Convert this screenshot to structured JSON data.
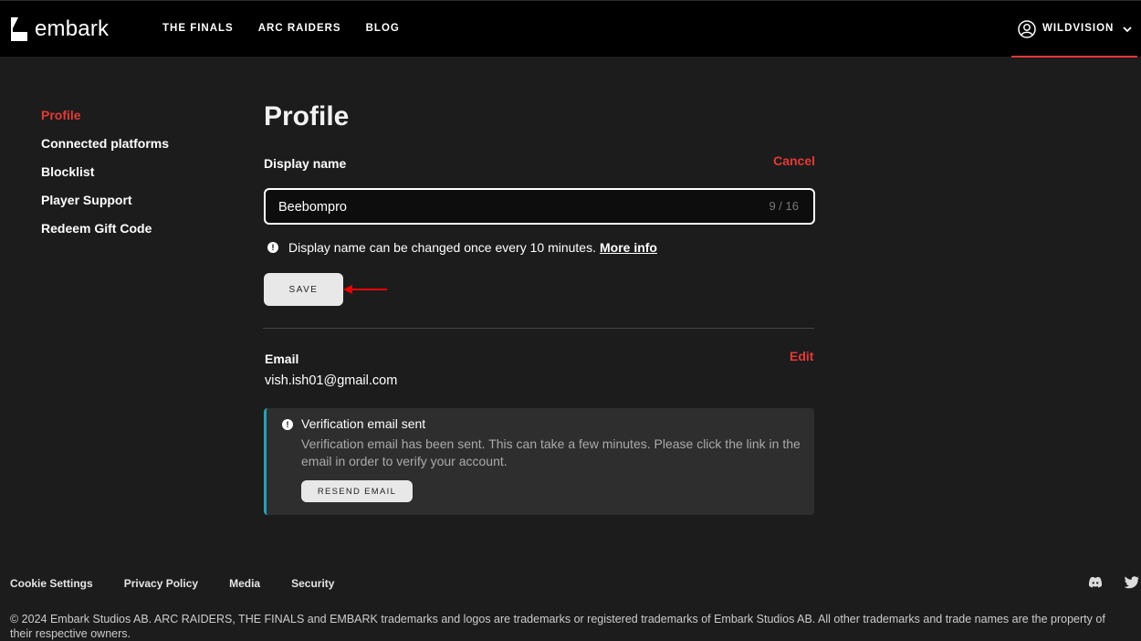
{
  "header": {
    "brand": "embark",
    "nav": [
      "THE FINALS",
      "ARC RAIDERS",
      "BLOG"
    ],
    "username": "WILDVISION",
    "accent_color": "#e53935"
  },
  "sidebar": {
    "items": [
      {
        "label": "Profile",
        "active": true
      },
      {
        "label": "Connected platforms",
        "active": false
      },
      {
        "label": "Blocklist",
        "active": false
      },
      {
        "label": "Player Support",
        "active": false
      },
      {
        "label": "Redeem Gift Code",
        "active": false
      }
    ]
  },
  "profile": {
    "title": "Profile",
    "display_name_label": "Display name",
    "cancel_label": "Cancel",
    "display_name_value": "Beebompro",
    "char_counter": "9 / 16",
    "hint_text": "Display name can be changed once every 10 minutes.",
    "hint_link": "More info",
    "save_label": "SAVE"
  },
  "email": {
    "label": "Email",
    "edit_label": "Edit",
    "value": "vish.ish01@gmail.com",
    "notice": {
      "title": "Verification email sent",
      "body": "Verification email has been sent. This can take a few minutes. Please click the link in the email in order to verify your account.",
      "resend_label": "RESEND EMAIL",
      "accent_color": "#1fa3b5"
    }
  },
  "footer": {
    "links": [
      "Cookie Settings",
      "Privacy Policy",
      "Media",
      "Security"
    ],
    "social": [
      "discord-icon",
      "twitter-icon"
    ],
    "copyright": "© 2024 Embark Studios AB. ARC RAIDERS, THE FINALS and EMBARK trademarks and logos are trademarks or registered trademarks of Embark Studios AB. All other trademarks and trade names are the property of their respective owners."
  }
}
